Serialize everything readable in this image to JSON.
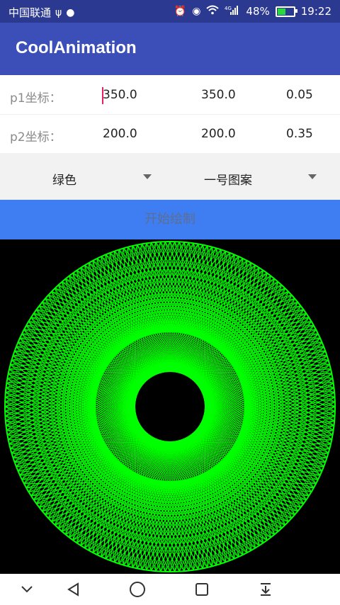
{
  "status": {
    "carrier": "中国联通",
    "battery_text": "48%",
    "battery_level": 0.48,
    "time": "19:22",
    "network": "4G",
    "icons": [
      "usb-icon",
      "wechat-icon",
      "alarm-icon",
      "eye-icon",
      "wifi-icon",
      "signal-icon",
      "battery-icon"
    ]
  },
  "appbar": {
    "title": "CoolAnimation"
  },
  "form": {
    "p1_label": "p1坐标：",
    "p1_x": "350.0",
    "p1_y": "350.0",
    "p1_z": "0.05",
    "p2_label": "p2坐标：",
    "p2_x": "200.0",
    "p2_y": "200.0",
    "p2_z": "0.35"
  },
  "spinners": {
    "color_selected": "绿色",
    "pattern_selected": "一号图案"
  },
  "actions": {
    "start_label": "开始绘制"
  },
  "drawing": {
    "line_color": "#00ff00",
    "background": "#000000"
  },
  "navbar": {
    "icons": [
      "chevron-down-icon",
      "back-icon",
      "home-icon",
      "recents-icon",
      "notification-pull-icon"
    ]
  }
}
